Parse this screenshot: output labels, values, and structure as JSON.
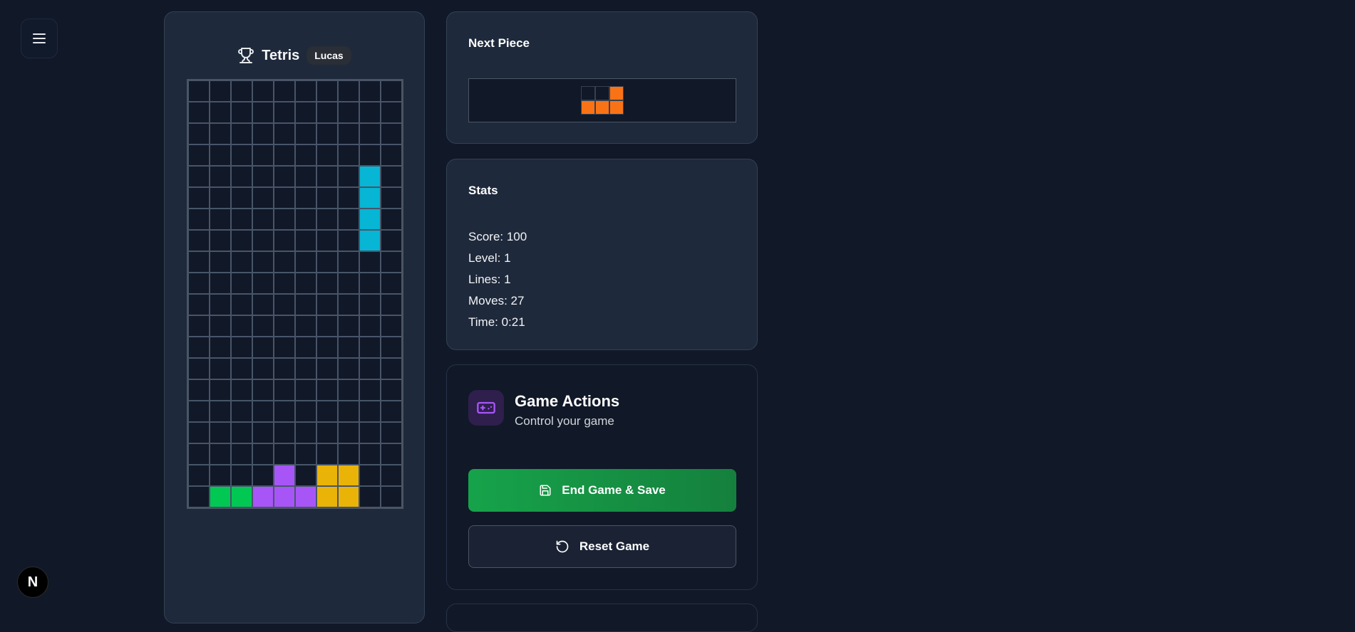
{
  "board": {
    "title": "Tetris",
    "player": "Lucas",
    "cols": 10,
    "rows": 20,
    "cells": [
      {
        "r": 4,
        "c": 8,
        "color": "#06b6d4"
      },
      {
        "r": 5,
        "c": 8,
        "color": "#06b6d4"
      },
      {
        "r": 6,
        "c": 8,
        "color": "#06b6d4"
      },
      {
        "r": 7,
        "c": 8,
        "color": "#06b6d4"
      },
      {
        "r": 18,
        "c": 4,
        "color": "#a855f7"
      },
      {
        "r": 18,
        "c": 6,
        "color": "#eab308"
      },
      {
        "r": 18,
        "c": 7,
        "color": "#eab308"
      },
      {
        "r": 19,
        "c": 1,
        "color": "#00c853"
      },
      {
        "r": 19,
        "c": 2,
        "color": "#00c853"
      },
      {
        "r": 19,
        "c": 3,
        "color": "#a855f7"
      },
      {
        "r": 19,
        "c": 4,
        "color": "#a855f7"
      },
      {
        "r": 19,
        "c": 5,
        "color": "#a855f7"
      },
      {
        "r": 19,
        "c": 6,
        "color": "#eab308"
      },
      {
        "r": 19,
        "c": 7,
        "color": "#eab308"
      }
    ]
  },
  "next_piece": {
    "title": "Next Piece",
    "color": "#f97316",
    "shape": [
      [
        0,
        0,
        1
      ],
      [
        1,
        1,
        1
      ]
    ]
  },
  "stats": {
    "title": "Stats",
    "score": "Score: 100",
    "level": "Level: 1",
    "lines": "Lines: 1",
    "moves": "Moves: 27",
    "time": "Time: 0:21"
  },
  "actions": {
    "title": "Game Actions",
    "subtitle": "Control your game",
    "save_label": "End Game & Save",
    "reset_label": "Reset Game",
    "icon": "gamepad-icon"
  },
  "badge": "N"
}
